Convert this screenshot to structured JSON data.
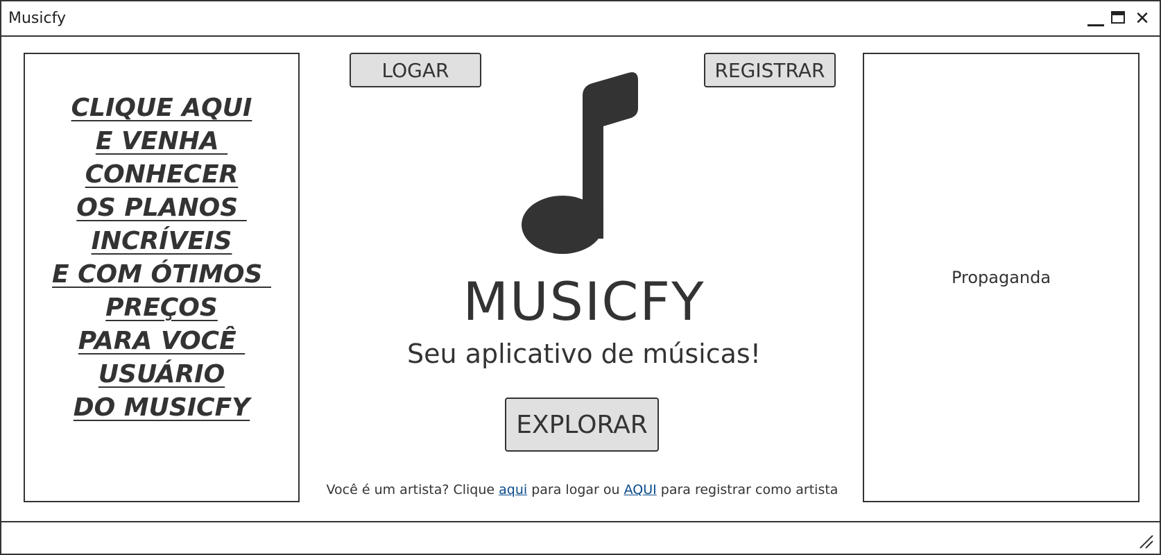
{
  "window": {
    "title": "Musicfy"
  },
  "left_panel": {
    "lines": [
      "CLIQUE AQUI",
      "E VENHA ",
      "CONHECER",
      "OS PLANOS ",
      "INCRÍVEIS",
      "E COM ÓTIMOS ",
      "PREÇOS",
      "PARA VOCÊ ",
      "USUÁRIO",
      "DO MUSICFY"
    ]
  },
  "header": {
    "login_label": "LOGAR",
    "register_label": "REGISTRAR"
  },
  "main": {
    "icon": "music-note-icon",
    "brand": "MUSICFY",
    "subtitle": "Seu aplicativo de músicas!",
    "explore_label": "EXPLORAR",
    "artist_text_1": "Você é um artista? Clique ",
    "artist_link_login": "aqui",
    "artist_text_2": " para logar ou ",
    "artist_link_register": "AQUI",
    "artist_text_3": " para registrar como artista"
  },
  "right_panel": {
    "label": "Propaganda"
  },
  "colors": {
    "ink": "#333333",
    "button_fill": "#e0e0e0",
    "link": "#0a4a8a"
  }
}
